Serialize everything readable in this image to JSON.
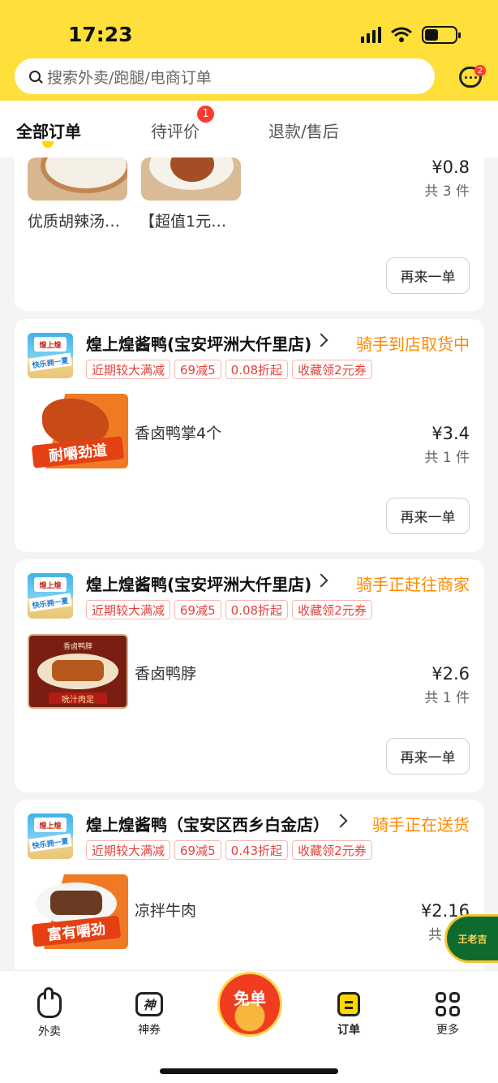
{
  "status_bar": {
    "time": "17:23"
  },
  "search": {
    "placeholder": "搜索外卖/跑腿/电商订单",
    "message_badge": "2"
  },
  "tabs": [
    {
      "label": "全部订单",
      "active": true
    },
    {
      "label": "待评价",
      "badge": "1"
    },
    {
      "label": "退款/售后"
    }
  ],
  "orders": [
    {
      "items": [
        {
          "name": "优质胡辣汤…"
        },
        {
          "name": "【超值1元…"
        }
      ],
      "price": "¥0.8",
      "count": "共 3 件",
      "reorder_label": "再来一单"
    },
    {
      "store": "煌上煌酱鸭(宝安坪洲大仟里店)",
      "status": "骑手到店取货中",
      "logo_text": "煌上煌",
      "logo_banner": "快乐拥一夏",
      "tags": [
        "近期较大满减",
        "69减5",
        "0.08折起",
        "收藏领2元券"
      ],
      "item_name": "香卤鸭掌4个",
      "image_tagline": "耐嚼劲道",
      "price": "¥3.4",
      "count": "共 1 件",
      "reorder_label": "再来一单"
    },
    {
      "store": "煌上煌酱鸭(宝安坪洲大仟里店)",
      "status": "骑手正赶往商家",
      "logo_text": "煌上煌",
      "logo_banner": "快乐拥一夏",
      "tags": [
        "近期较大满减",
        "69减5",
        "0.08折起",
        "收藏领2元券"
      ],
      "item_name": "香卤鸭脖",
      "image_header": "香卤鸭脖",
      "image_tagline": "吮汁肉足",
      "price": "¥2.6",
      "count": "共 1 件",
      "reorder_label": "再来一单"
    },
    {
      "store": "煌上煌酱鸭（宝安区西乡白金店）",
      "status": "骑手正在送货",
      "logo_text": "煌上煌",
      "logo_banner": "快乐拥一夏",
      "tags": [
        "近期较大满减",
        "69减5",
        "0.43折起",
        "收藏领2元券"
      ],
      "item_name": "凉拌牛肉",
      "image_tagline": "富有嚼劲",
      "price": "¥2.16",
      "count": "共"
    }
  ],
  "floating_badge": "王老吉",
  "bottom_nav": [
    {
      "label": "外卖",
      "icon": "takeout-icon"
    },
    {
      "label": "神券",
      "icon": "coupon-icon",
      "icon_text": "神"
    },
    {
      "label": "免单",
      "icon": "free-order-icon"
    },
    {
      "label": "订单",
      "icon": "order-icon",
      "active": true
    },
    {
      "label": "更多",
      "icon": "more-icon"
    }
  ],
  "colors": {
    "brand_yellow": "#ffdf3a",
    "status_orange": "#ff8a00",
    "tag_red": "#e5413a"
  }
}
